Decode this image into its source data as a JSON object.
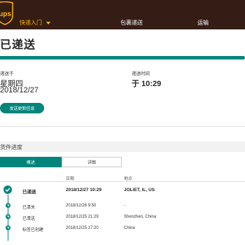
{
  "header": {
    "logo_text": "ups",
    "quick_links": "快递入门",
    "ship": "包裹递送",
    "track": "运输"
  },
  "status": {
    "title": "已递送",
    "delivered_on_label": "递送于",
    "weekday": "星期四",
    "date": "2018/12/27",
    "time_label": "递送时间",
    "time": "于 10:29",
    "update_button": "发送更新信息"
  },
  "progress": {
    "section_title": "货件进度",
    "tabs": [
      "概述",
      "详图"
    ],
    "columns": [
      "日期",
      "地点"
    ],
    "rows": [
      {
        "status": "已递送",
        "date": "2018/12/27  10:29",
        "location": "JOLIET, IL, US"
      },
      {
        "status": "已清关",
        "date": "2018/12/26  9:50",
        "location": "-"
      },
      {
        "status": "已清送",
        "date": "2018/12/25  21:29",
        "location": "Shenzhen, China"
      },
      {
        "status": "标签已创建",
        "date": "2018/12/25  17:20",
        "location": "China"
      }
    ]
  },
  "colors": {
    "brand_brown": "#351c15",
    "brand_gold": "#ffb500",
    "accent_teal": "#00857d"
  },
  "icons": [
    "ups-shield-logo",
    "caret-down-icon",
    "check-icon",
    "timeline-dot-icon"
  ]
}
